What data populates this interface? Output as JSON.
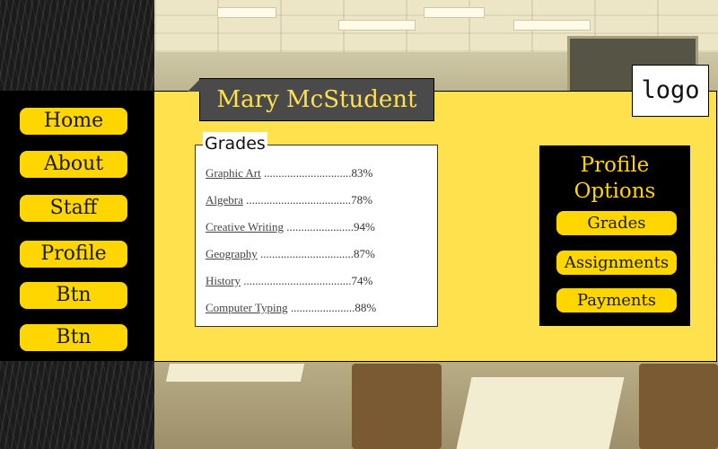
{
  "nav": {
    "items": [
      "Home",
      "About",
      "Staff",
      "Profile",
      "Btn",
      "Btn"
    ]
  },
  "header": {
    "student_name": "Mary McStudent",
    "logo_text": "logo"
  },
  "grades": {
    "title": "Grades",
    "rows": [
      {
        "subject": "Graphic Art",
        "dots": "..............................",
        "score": "83%"
      },
      {
        "subject": "Algebra",
        "dots": "....................................",
        "score": "78%"
      },
      {
        "subject": "Creative Writing",
        "dots": ".......................",
        "score": "94%"
      },
      {
        "subject": "Geography",
        "dots": "................................",
        "score": "87%"
      },
      {
        "subject": "History",
        "dots": ".....................................",
        "score": "74%"
      },
      {
        "subject": "Computer Typing",
        "dots": "......................",
        "score": "88%"
      }
    ]
  },
  "profile_options": {
    "title_line1": "Profile",
    "title_line2": "Options",
    "buttons": [
      "Grades",
      "Assignments",
      "Payments"
    ]
  },
  "colors": {
    "panel_yellow": "#ffe04d",
    "button_yellow": "#ffd600",
    "dark": "#000000",
    "name_tab": "#4a4a4a"
  }
}
